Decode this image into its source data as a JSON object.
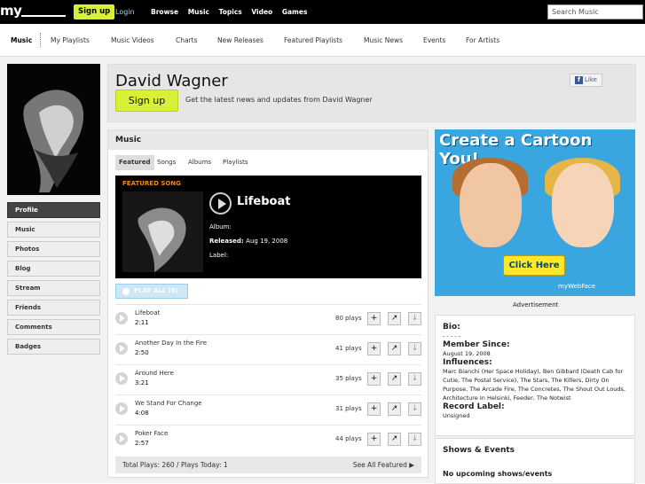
{
  "topbar": {
    "logo": "my",
    "signup": "Sign up",
    "login": "Login",
    "nav": [
      "Browse",
      "Music",
      "Topics",
      "Video",
      "Games"
    ],
    "search_placeholder": "Search Music"
  },
  "subnav": {
    "items": [
      "Music",
      "My Playlists",
      "Music Videos",
      "Charts",
      "New Releases",
      "Featured Playlists",
      "Music News",
      "Events",
      "For Artists"
    ]
  },
  "sidebar": {
    "items": [
      "Profile",
      "Music",
      "Photos",
      "Blog",
      "Stream",
      "Friends",
      "Comments",
      "Badges"
    ]
  },
  "header": {
    "artist": "David Wagner",
    "signup": "Sign up",
    "tagline": "Get the latest news and updates from David Wagner",
    "like": "Like"
  },
  "music": {
    "title": "Music",
    "tabs": [
      "Featured",
      "Songs",
      "Albums",
      "Playlists"
    ],
    "featured_label": "FEATURED SONG",
    "song": "Lifeboat",
    "album_label": "Album:",
    "released_label": "Released:",
    "released": "Aug 19, 2008",
    "label_label": "Label:",
    "play_all": "PLAY ALL (8)"
  },
  "tracks": [
    {
      "name": "Lifeboat",
      "duration": "2:11",
      "plays": "80 plays"
    },
    {
      "name": "Another Day In the Fire",
      "duration": "2:50",
      "plays": "41 plays"
    },
    {
      "name": "Around Here",
      "duration": "3:21",
      "plays": "35 plays"
    },
    {
      "name": "We Stand For Change",
      "duration": "4:08",
      "plays": "31 plays"
    },
    {
      "name": "Poker Face",
      "duration": "2:57",
      "plays": "44 plays"
    }
  ],
  "footer": {
    "totals": "Total Plays: 260 / Plays Today: 1",
    "see_all": "See All Featured ▶"
  },
  "ad": {
    "title": "Create a Cartoon You!",
    "button": "Click Here",
    "brand": "myWebFace",
    "caption": "Advertisement"
  },
  "bio": {
    "bio_label": "Bio:",
    "bio_value": "- - - - -",
    "member_label": "Member Since:",
    "member_value": "August 19, 2008",
    "influences_label": "Influences:",
    "influences_value": "Marc Bianchi (Her Space Holiday), Ben Gibbard (Death Cab for Cutie, The Postal Service), The Stars, The Killers, Dirty On Purpose, The Arcade Fire, The Concretes, The Shout Out Louds, Architecture In Helsinki, Feeder, The Notwist",
    "record_label": "Record Label:",
    "record_value": "Unsigned"
  },
  "shows": {
    "title": "Shows & Events",
    "empty": "No upcoming shows/events"
  }
}
